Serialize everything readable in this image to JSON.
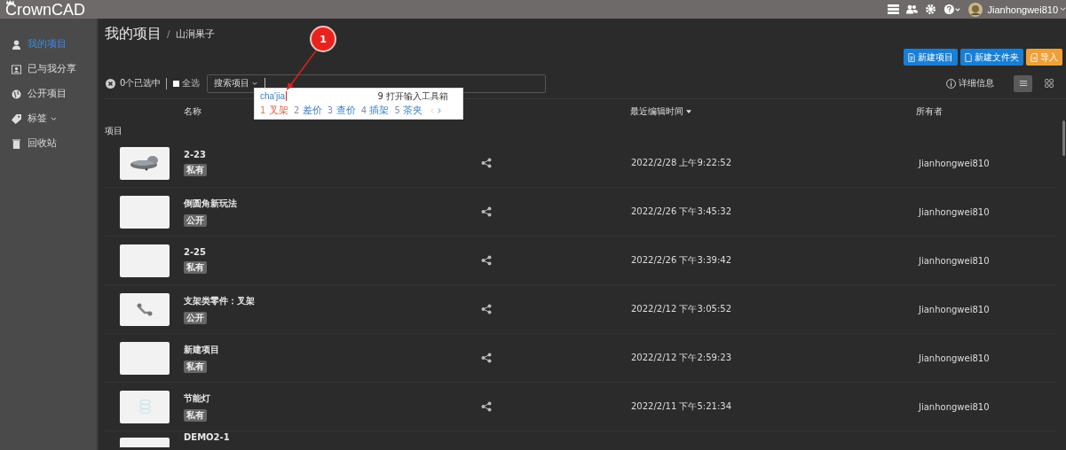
{
  "topbar": {
    "logo": "CrownCAD",
    "username": "Jianhongwei810"
  },
  "sidebar": {
    "items": [
      {
        "label": "我的项目",
        "kind": "user",
        "selected": true
      },
      {
        "label": "已与我分享",
        "kind": "contact",
        "selected": false
      },
      {
        "label": "公开项目",
        "kind": "globe",
        "selected": false
      },
      {
        "label": "标签",
        "kind": "tag",
        "selected": false,
        "dropdown": true
      },
      {
        "label": "回收站",
        "kind": "trash",
        "selected": false
      }
    ]
  },
  "breadcrumb": {
    "title": "我的项目",
    "separator": "/",
    "current": "山涧果子"
  },
  "actions": [
    {
      "label": "新建项目",
      "kind": "project"
    },
    {
      "label": "新建文件夹",
      "kind": "folder"
    },
    {
      "label": "导入",
      "kind": "import"
    }
  ],
  "toolbar": {
    "selected_count": "0个已选中",
    "select_all": {
      "label": "全选",
      "checked": false
    },
    "search_scope": "搜索项目",
    "details": "详细信息",
    "views": [
      {
        "kind": "list",
        "selected": true
      },
      {
        "kind": "grid",
        "selected": false
      }
    ]
  },
  "ime": {
    "input": "cha'jia",
    "toolbox": "9 打开输入工具箱",
    "candidates": [
      {
        "number": "1",
        "word": "叉架",
        "selected": true
      },
      {
        "number": "2",
        "word": "差价",
        "selected": false
      },
      {
        "number": "3",
        "word": "查价",
        "selected": false
      },
      {
        "number": "4",
        "word": "插架",
        "selected": false
      },
      {
        "number": "5",
        "word": "茶夹",
        "selected": false
      }
    ]
  },
  "annotation": {
    "number": "1"
  },
  "table": {
    "columns": [
      "名称",
      "最近编辑时间",
      "所有者"
    ],
    "section": "项目",
    "rows": [
      {
        "name": "2-23",
        "tag": "私有",
        "kind": "model",
        "date": "2022/2/28 上午9:22:52",
        "owner": "Jianhongwei810"
      },
      {
        "name": "倒圆角新玩法",
        "tag": "公开",
        "kind": "blank",
        "date": "2022/2/26 下午3:45:32",
        "owner": "Jianhongwei810"
      },
      {
        "name": "2-25",
        "tag": "私有",
        "kind": "blank",
        "date": "2022/2/26 下午3:39:42",
        "owner": "Jianhongwei810"
      },
      {
        "name": "支架类零件：叉架",
        "tag": "公开",
        "kind": "bracket",
        "date": "2022/2/12 下午3:05:52",
        "owner": "Jianhongwei810"
      },
      {
        "name": "新建项目",
        "tag": "私有",
        "kind": "blank",
        "date": "2022/2/12 下午2:59:23",
        "owner": "Jianhongwei810"
      },
      {
        "name": "节能灯",
        "tag": "私有",
        "kind": "coil",
        "date": "2022/2/11 下午5:21:34",
        "owner": "Jianhongwei810"
      },
      {
        "name": "DEMO2-1",
        "kind": "blank"
      }
    ]
  }
}
